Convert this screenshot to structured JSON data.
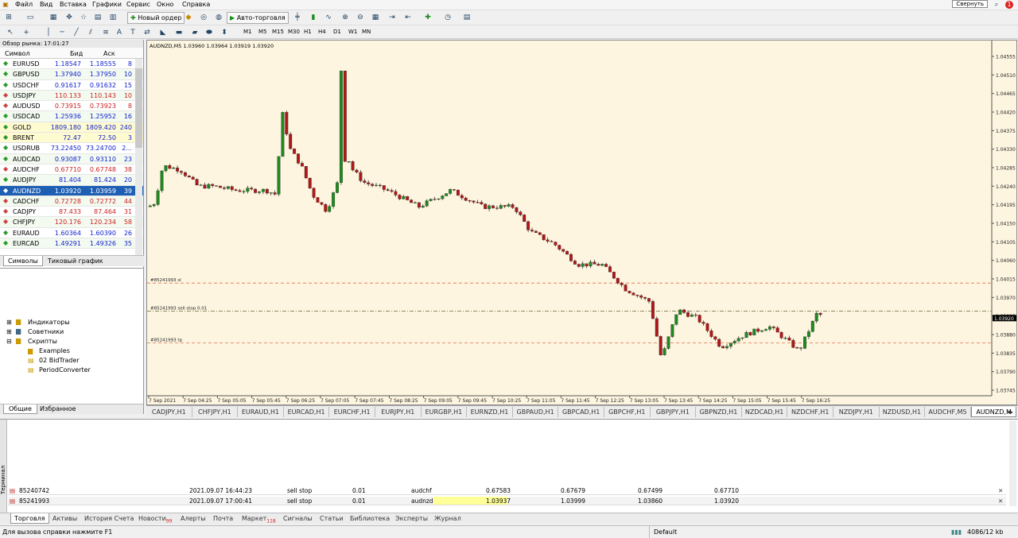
{
  "menu": [
    "Файл",
    "Вид",
    "Вставка",
    "Графики",
    "Сервис",
    "Окно",
    "Справка"
  ],
  "collapse": "Свернуть",
  "notif_count": "1",
  "toolbar": {
    "new_order": "Новый ордер",
    "auto_trading": "Авто-торговля",
    "timeframes": [
      "M1",
      "M5",
      "M15",
      "M30",
      "H1",
      "H4",
      "D1",
      "W1",
      "MN"
    ]
  },
  "market_watch": {
    "title": "Обзор рынка: 17:01:27",
    "col_symbol": "Символ",
    "col_bid": "Бид",
    "col_ask": "Аск",
    "rows": [
      {
        "s": "EURUSD",
        "b": "1.18547",
        "a": "1.18555",
        "sp": "8",
        "d": "up"
      },
      {
        "s": "GBPUSD",
        "b": "1.37940",
        "a": "1.37950",
        "sp": "10",
        "d": "up"
      },
      {
        "s": "USDCHF",
        "b": "0.91617",
        "a": "0.91632",
        "sp": "15",
        "d": "up"
      },
      {
        "s": "USDJPY",
        "b": "110.133",
        "a": "110.143",
        "sp": "10",
        "d": "dn"
      },
      {
        "s": "AUDUSD",
        "b": "0.73915",
        "a": "0.73923",
        "sp": "8",
        "d": "dn"
      },
      {
        "s": "USDCAD",
        "b": "1.25936",
        "a": "1.25952",
        "sp": "16",
        "d": "up"
      },
      {
        "s": "GOLD",
        "b": "1809.180",
        "a": "1809.420",
        "sp": "240",
        "d": "up"
      },
      {
        "s": "BRENT",
        "b": "72.47",
        "a": "72.50",
        "sp": "3",
        "d": "up"
      },
      {
        "s": "USDRUB",
        "b": "73.22450",
        "a": "73.24700",
        "sp": "2...",
        "d": "up"
      },
      {
        "s": "AUDCAD",
        "b": "0.93087",
        "a": "0.93110",
        "sp": "23",
        "d": "up"
      },
      {
        "s": "AUDCHF",
        "b": "0.67710",
        "a": "0.67748",
        "sp": "38",
        "d": "dn"
      },
      {
        "s": "AUDJPY",
        "b": "81.404",
        "a": "81.424",
        "sp": "20",
        "d": "up"
      },
      {
        "s": "AUDNZD",
        "b": "1.03920",
        "a": "1.03959",
        "sp": "39",
        "d": "sel"
      },
      {
        "s": "CADCHF",
        "b": "0.72728",
        "a": "0.72772",
        "sp": "44",
        "d": "dn"
      },
      {
        "s": "CADJPY",
        "b": "87.433",
        "a": "87.464",
        "sp": "31",
        "d": "dn"
      },
      {
        "s": "CHFJPY",
        "b": "120.176",
        "a": "120.234",
        "sp": "58",
        "d": "dn"
      },
      {
        "s": "EURAUD",
        "b": "1.60364",
        "a": "1.60390",
        "sp": "26",
        "d": "up"
      },
      {
        "s": "EURCAD",
        "b": "1.49291",
        "a": "1.49326",
        "sp": "35",
        "d": "up"
      }
    ],
    "tabs": [
      "Символы",
      "Тиковый график"
    ]
  },
  "navigator": {
    "items": [
      "Индикаторы",
      "Советники",
      "Скрипты",
      "Examples",
      "02 BidTrader",
      "PeriodConverter"
    ],
    "tabs": [
      "Общие",
      "Избранное"
    ]
  },
  "chart": {
    "header": "AUDNZD,M5  1.03960 1.03964 1.03919 1.03920",
    "price_labels": [
      "1.04555",
      "1.04510",
      "1.04465",
      "1.04420",
      "1.04375",
      "1.04330",
      "1.04285",
      "1.04240",
      "1.04195",
      "1.04150",
      "1.04105",
      "1.04060",
      "1.04015",
      "1.03970",
      "1.03925",
      "1.03880",
      "1.03835",
      "1.03790",
      "1.03745"
    ],
    "current_price": "1.03920",
    "time_labels": [
      "7 Sep 2021",
      "7 Sep 04:25",
      "7 Sep 05:05",
      "7 Sep 05:45",
      "7 Sep 06:25",
      "7 Sep 07:05",
      "7 Sep 07:45",
      "7 Sep 08:25",
      "7 Sep 09:05",
      "7 Sep 09:45",
      "7 Sep 10:25",
      "7 Sep 11:05",
      "7 Sep 11:45",
      "7 Sep 12:25",
      "7 Sep 13:05",
      "7 Sep 13:45",
      "7 Sep 14:25",
      "7 Sep 15:05",
      "7 Sep 15:45",
      "7 Sep 16:25"
    ],
    "lines": [
      {
        "label": "#85241993 sl",
        "price": 1.04005
      },
      {
        "label": "#85241993 sell stop 0.01",
        "price": 1.03937
      },
      {
        "label": "#85241993 tp",
        "price": 1.0386
      }
    ]
  },
  "chart_tabs": [
    "CADJPY,H1",
    "CHFJPY,H1",
    "EURAUD,H1",
    "EURCAD,H1",
    "EURCHF,H1",
    "EURJPY,H1",
    "EURGBP,H1",
    "EURNZD,H1",
    "GBPAUD,H1",
    "GBPCAD,H1",
    "GBPCHF,H1",
    "GBPJPY,H1",
    "GBPNZD,H1",
    "NZDCAD,H1",
    "NZDCHF,H1",
    "NZDJPY,H1",
    "NZDUSD,H1",
    "AUDCHF,M5",
    "AUDNZD,M"
  ],
  "orders": [
    {
      "id": "85240742",
      "time": "2021.09.07 16:44:23",
      "type": "sell stop",
      "vol": "0.01",
      "sym": "audchf",
      "price": "0.67583",
      "sl": "0.67679",
      "tp": "0.67499",
      "cur": "0.67710"
    },
    {
      "id": "85241993",
      "time": "2021.09.07 17:00:41",
      "type": "sell stop",
      "vol": "0.01",
      "sym": "audnzd",
      "price": "1.03937",
      "sl": "1.03999",
      "tp": "1.03860",
      "cur": "1.03920"
    }
  ],
  "terminal": {
    "side_label": "Терминал",
    "tabs": [
      "Торговля",
      "Активы",
      "История Счета",
      "Новости",
      "Алерты",
      "Почта",
      "Маркет",
      "Сигналы",
      "Статьи",
      "Библиотека",
      "Эксперты",
      "Журнал"
    ],
    "news_badge": "99",
    "market_badge": "118"
  },
  "status": {
    "help": "Для вызова справки нажмите F1",
    "profile": "Default",
    "traffic": "4086/12 kb"
  },
  "colors": {
    "bull": "#1e8a1e",
    "bear": "#b01818",
    "chart_bg": "#fdf5e0",
    "selected": "#1e5fb4"
  }
}
